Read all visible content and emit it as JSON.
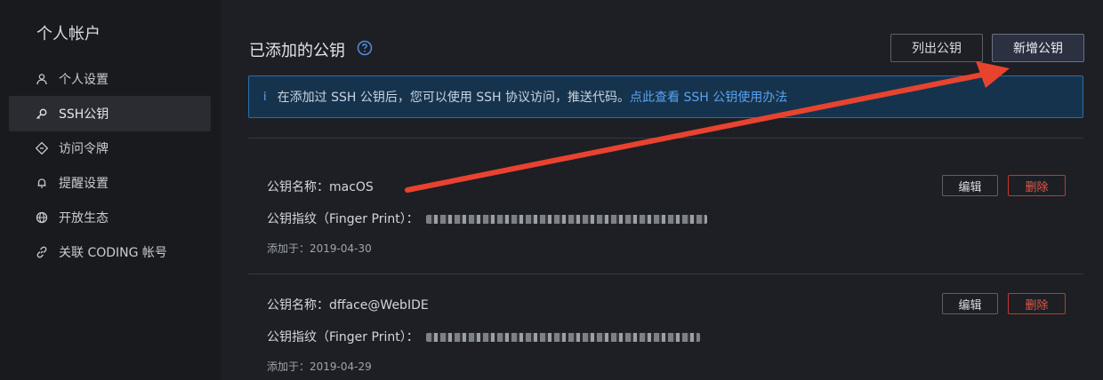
{
  "sidebar": {
    "title": "个人帐户",
    "items": [
      {
        "label": "个人设置",
        "icon": "user-icon"
      },
      {
        "label": "SSH公钥",
        "icon": "key-icon"
      },
      {
        "label": "访问令牌",
        "icon": "token-icon"
      },
      {
        "label": "提醒设置",
        "icon": "bell-icon"
      },
      {
        "label": "开放生态",
        "icon": "globe-icon"
      },
      {
        "label": "关联 CODING 帐号",
        "icon": "link-icon"
      }
    ],
    "active_index": 1
  },
  "main": {
    "title": "已添加的公钥",
    "help_icon": "question-circle-icon",
    "list_button": "列出公钥",
    "add_button": "新增公钥",
    "info": {
      "icon": "i",
      "text": "在添加过 SSH 公钥后，您可以使用 SSH 协议访问，推送代码。",
      "link": "点此查看 SSH 公钥使用办法"
    },
    "keys": [
      {
        "name_label": "公钥名称：",
        "name": "macOS",
        "fingerprint_label": "公钥指纹（Finger Print）：",
        "added_label": "添加于：",
        "added_date": "2019-04-30",
        "edit_label": "编辑",
        "delete_label": "删除"
      },
      {
        "name_label": "公钥名称：",
        "name": "dfface@WebIDE",
        "fingerprint_label": "公钥指纹（Finger Print）：",
        "added_label": "添加于：",
        "added_date": "2019-04-29",
        "edit_label": "编辑",
        "delete_label": "删除"
      }
    ]
  },
  "colors": {
    "background": "#1d1f24",
    "sidebar": "#191a1e",
    "accent_link": "#5aa3ef",
    "danger": "#e05a4a",
    "annotation_arrow": "#e8432e"
  }
}
